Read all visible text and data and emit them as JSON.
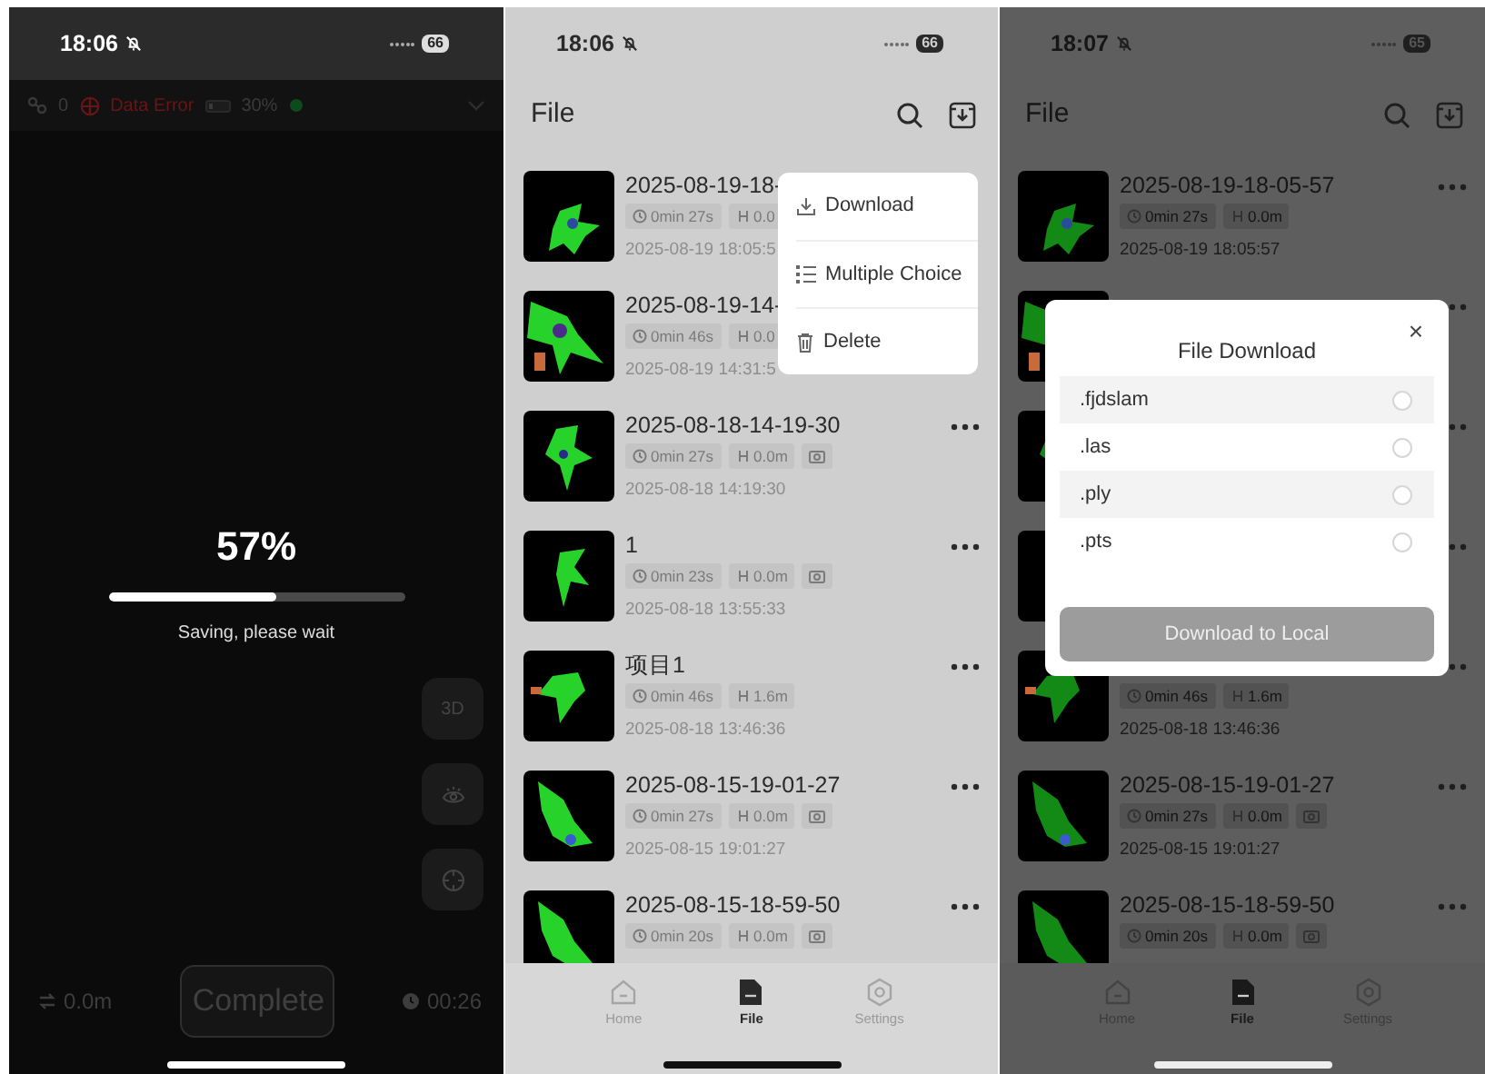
{
  "capture_screen": {
    "status_bar": {
      "time": "18:06",
      "battery": "66"
    },
    "toolbar": {
      "count": "0",
      "error": "Data Error",
      "battery": "30%"
    },
    "progress": {
      "percent": "57%",
      "level": 0.57,
      "message": "Saving, please wait"
    },
    "side_buttons": [
      {
        "kind": "text",
        "label": "3D"
      },
      {
        "kind": "eye"
      },
      {
        "kind": "target"
      }
    ],
    "footer": {
      "distance": "0.0m",
      "button": "Complete",
      "timer": "00:26"
    }
  },
  "file_screen_menu": {
    "status_bar": {
      "time": "18:06",
      "battery": "66"
    },
    "title": "File",
    "files": [
      {
        "title": "2025-08-19-18-",
        "duration": "0min 27s",
        "distance": "0.0",
        "date": "2025-08-19 18:05:5",
        "photo": false,
        "more_button": false
      },
      {
        "title": "2025-08-19-14-",
        "duration": "0min 46s",
        "distance": "0.0",
        "date": "2025-08-19 14:31:5",
        "photo": false,
        "more_button": false
      },
      {
        "title": "2025-08-18-14-19-30",
        "duration": "0min 27s",
        "distance": "0.0m",
        "date": "2025-08-18 14:19:30",
        "photo": true,
        "more_button": true
      },
      {
        "title": "1",
        "duration": "0min 23s",
        "distance": "0.0m",
        "date": "2025-08-18 13:55:33",
        "photo": true,
        "more_button": true
      },
      {
        "title": "项目1",
        "duration": "0min 46s",
        "distance": "1.6m",
        "date": "2025-08-18 13:46:36",
        "photo": false,
        "more_button": true
      },
      {
        "title": "2025-08-15-19-01-27",
        "duration": "0min 27s",
        "distance": "0.0m",
        "date": "2025-08-15 19:01:27",
        "photo": true,
        "more_button": true
      },
      {
        "title": "2025-08-15-18-59-50",
        "duration": "0min 20s",
        "distance": "0.0m",
        "photo": true,
        "more_button": true
      }
    ],
    "context_menu": [
      {
        "kind": "download",
        "label": "Download"
      },
      {
        "kind": "multiple",
        "label": "Multiple Choice"
      },
      {
        "kind": "delete",
        "label": "Delete"
      }
    ],
    "tab_bar": [
      {
        "kind": "home",
        "label": "Home",
        "selected": false
      },
      {
        "kind": "file",
        "label": "File",
        "selected": true
      },
      {
        "kind": "settings",
        "label": "Settings",
        "selected": false
      }
    ]
  },
  "file_screen_dialog": {
    "status_bar": {
      "time": "18:07",
      "battery": "65"
    },
    "title": "File",
    "files": [
      {
        "title": "2025-08-19-18-05-57",
        "duration": "0min 27s",
        "distance": "0.0m",
        "date": "2025-08-19 18:05:57",
        "photo": false,
        "more_button": true
      },
      {
        "more_button": true
      },
      {
        "more_button": true
      },
      {
        "more_button": true
      },
      {
        "duration": "0min 46s",
        "distance": "1.6m",
        "date": "2025-08-18 13:46:36",
        "photo": false,
        "more_button": true
      },
      {
        "title": "2025-08-15-19-01-27",
        "duration": "0min 27s",
        "distance": "0.0m",
        "date": "2025-08-15 19:01:27",
        "photo": true,
        "more_button": true
      },
      {
        "title": "2025-08-15-18-59-50",
        "duration": "0min 20s",
        "distance": "0.0m",
        "photo": true,
        "more_button": true
      }
    ],
    "dialog": {
      "title": "File Download",
      "close": "×",
      "options": [
        {
          "label": ".fjdslam",
          "selected": false
        },
        {
          "label": ".las",
          "selected": false
        },
        {
          "label": ".ply",
          "selected": false
        },
        {
          "label": ".pts",
          "selected": false
        }
      ],
      "button": {
        "label": "Download to Local",
        "disabled": true
      }
    },
    "tab_bar": [
      {
        "kind": "home",
        "label": "Home",
        "selected": false
      },
      {
        "kind": "file",
        "label": "File",
        "selected": true
      },
      {
        "kind": "settings",
        "label": "Settings",
        "selected": false
      }
    ]
  }
}
